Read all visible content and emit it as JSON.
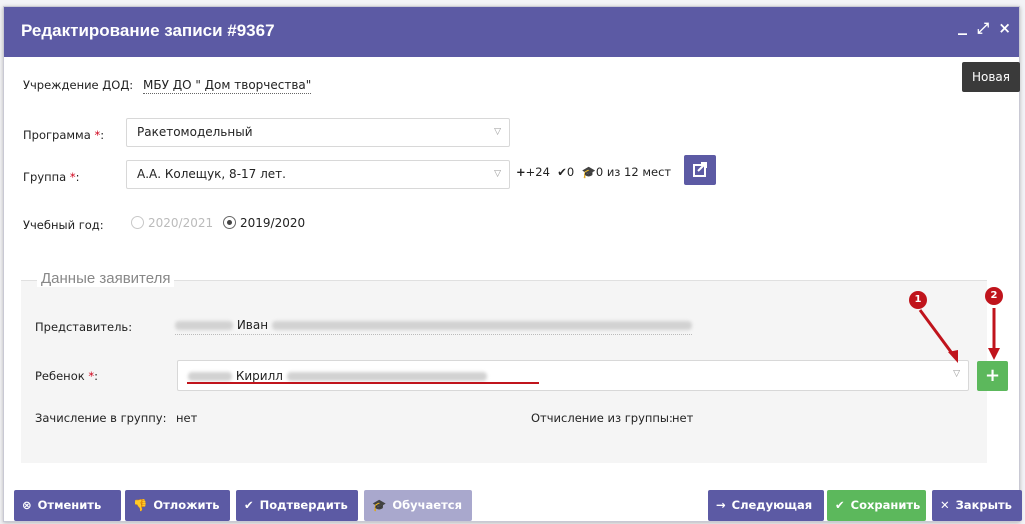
{
  "window": {
    "title": "Редактирование записи #9367",
    "min_glyph": "_",
    "max_glyph": "⤢",
    "close_glyph": "×"
  },
  "institution": {
    "label": "Учреждение ДОД:",
    "value": "МБУ ДО \" Дом творчества\""
  },
  "status_badge": "Новая",
  "program": {
    "label": "Программа",
    "required_mark": "*",
    "colon": ":",
    "value": "Ракетомодельный"
  },
  "group": {
    "label": "Группа",
    "required_mark": "*",
    "colon": ":",
    "value": "А.А. Колещук, 8-17 лет.",
    "stats": {
      "plus": "+24",
      "check": "0",
      "hat": "0 из 12 мест"
    }
  },
  "school_year": {
    "label": "Учебный год:",
    "options": [
      {
        "label": "2020/2021",
        "selected": false
      },
      {
        "label": "2019/2020",
        "selected": true
      }
    ]
  },
  "applicant": {
    "legend": "Данные заявителя",
    "representative_label": "Представитель:",
    "representative_name": "Иван",
    "child_label": "Ребенок",
    "child_required": "*",
    "child_colon": ":",
    "child_name": "Кирилл",
    "enrollment_label": "Зачисление в группу:",
    "enrollment_value": "нет",
    "expulsion_label": "Отчисление из группы:",
    "expulsion_value": "нет",
    "markers": [
      "1",
      "2"
    ]
  },
  "footer": {
    "cancel": "Отменить",
    "postpone": "Отложить",
    "confirm": "Подтвердить",
    "studying": "Обучается",
    "next": "Следующая",
    "save": "Сохранить",
    "close": "Закрыть"
  },
  "colors": {
    "titlebar": "#5c5aa4",
    "button_primary": "#5c5aa4",
    "button_success": "#5cb85c",
    "required": "#d0021b",
    "annotation": "#c0141c"
  }
}
